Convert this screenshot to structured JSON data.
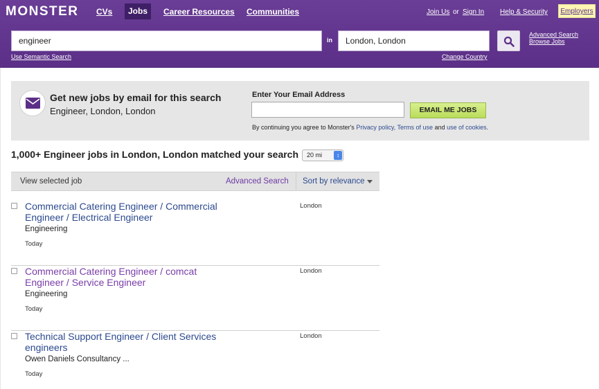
{
  "header": {
    "logo": "MONSTER",
    "nav": [
      {
        "label": "CVs"
      },
      {
        "label": "Jobs"
      },
      {
        "label": "Career Resources"
      },
      {
        "label": "Communities"
      }
    ],
    "join_us": "Join Us",
    "or": "or",
    "sign_in": "Sign In",
    "help": "Help & Security",
    "employers": "Employers",
    "accent_color": "#5b2f87"
  },
  "search": {
    "keyword_value": "engineer",
    "in_label": "in",
    "location_value": "London, London",
    "advanced_search": "Advanced Search",
    "browse_jobs": "Browse Jobs",
    "semantic_search": "Use Semantic Search",
    "change_country": "Change Country"
  },
  "alert": {
    "title": "Get new jobs by email for this search",
    "subtitle": "Engineer, London, London",
    "email_label": "Enter Your Email Address",
    "button": "EMAIL ME JOBS",
    "agree_prefix": "By continuing you agree to Monster's",
    "privacy": "Privacy policy,",
    "terms": "Terms of use",
    "and": "and",
    "cookies": "use of cookies",
    "period": "."
  },
  "results": {
    "title": "1,000+ Engineer jobs in London, London matched your search",
    "radius": "20 mi",
    "view_selected": "View selected job",
    "advanced_search": "Advanced Search",
    "sort": "Sort by relevance",
    "jobs": [
      {
        "title": "Commercial Catering Engineer / Commercial Engineer / Electrical Engineer",
        "company": "Engineering",
        "date": "Today",
        "location": "London"
      },
      {
        "title": "Commercial Catering Engineer / comcat Engineer / Service Engineer",
        "company": "Engineering",
        "date": "Today",
        "location": "London"
      },
      {
        "title": "Technical Support Engineer / Client Services engineers",
        "company": "Owen Daniels Consultancy ...",
        "date": "Today",
        "location": "London"
      }
    ]
  }
}
